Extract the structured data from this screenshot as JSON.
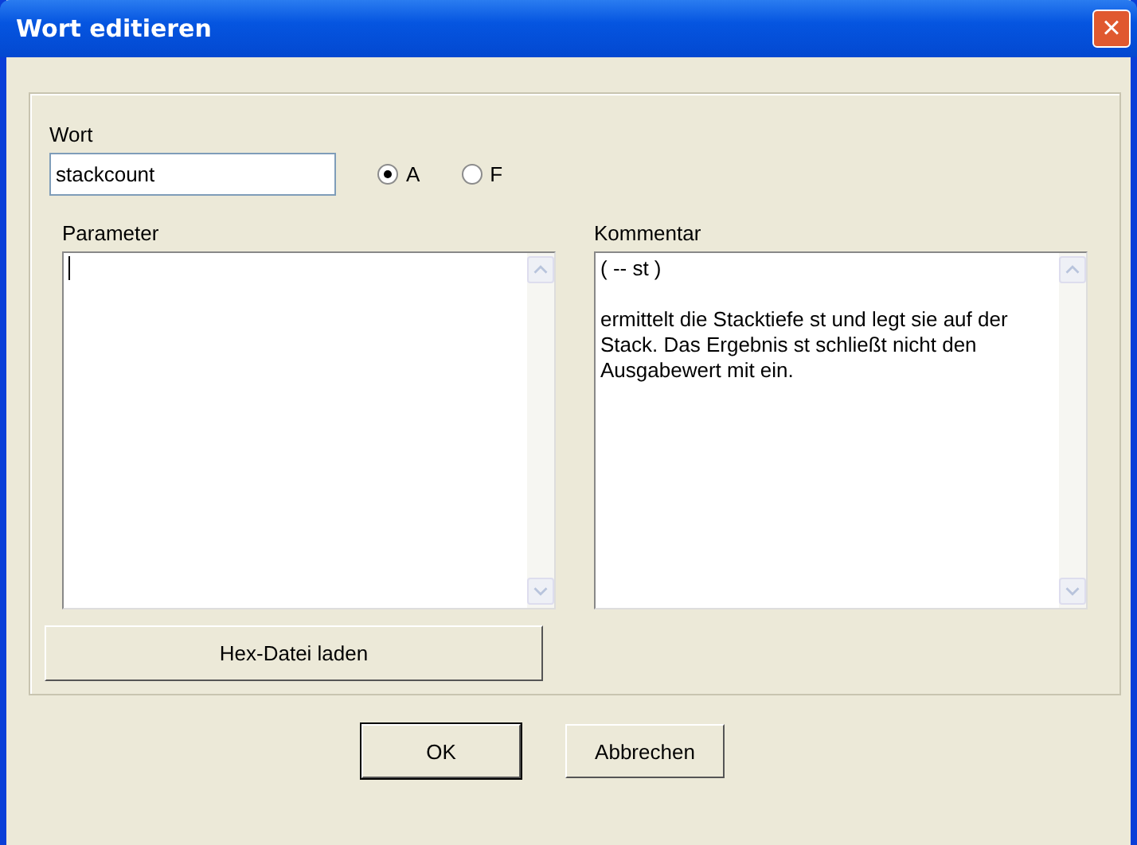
{
  "window": {
    "title": "Wort editieren",
    "close": "×"
  },
  "word": {
    "label": "Wort",
    "value": "stackcount"
  },
  "radios": [
    {
      "label": "A",
      "selected": true
    },
    {
      "label": "F",
      "selected": false
    }
  ],
  "parameter": {
    "label": "Parameter"
  },
  "comment": {
    "label": "Kommentar",
    "paragraphs": [
      "( -- st )",
      "ermittelt die Stacktiefe st und legt sie auf der Stack. Das Ergebnis st schließt nicht den Ausgabewert mit ein."
    ]
  },
  "load_button": "Hex-Datei laden",
  "buttons": [
    {
      "label": "OK",
      "default": true
    },
    {
      "label": "Abbrechen",
      "default": false
    }
  ]
}
